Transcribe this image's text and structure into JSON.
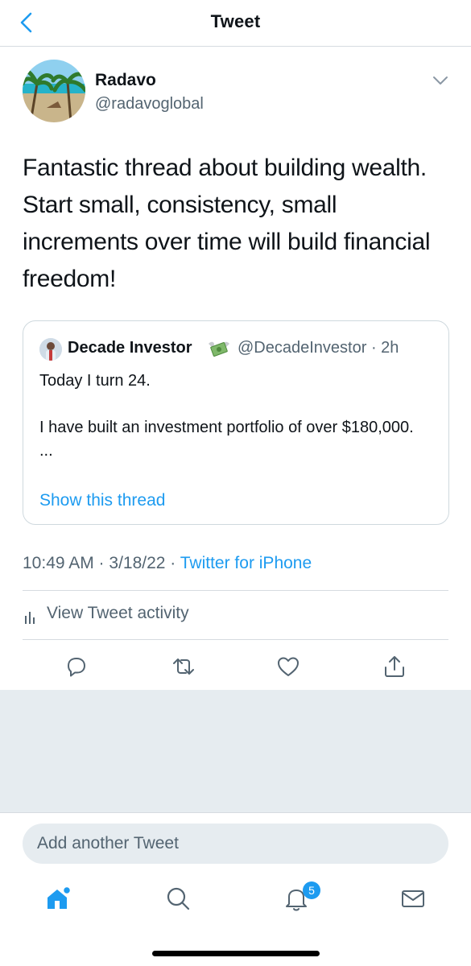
{
  "header": {
    "title": "Tweet",
    "back_icon": "chevron-left-icon"
  },
  "author": {
    "name": "Radavo",
    "handle": "@radavoglobal"
  },
  "tweet": {
    "text": "Fantastic thread about building wealth. Start small, consistency, small increments over time will build financial freedom!"
  },
  "quote": {
    "name": "Decade Investor",
    "emoji_icon": "money-with-wings-icon",
    "meta": "@DecadeInvestor · 2h",
    "text": "Today I turn 24.\n\nI have built an investment portfolio of over $180,000.\n...",
    "show_thread": "Show this thread"
  },
  "meta": {
    "time_date": "10:49 AM · 3/18/22 · ",
    "source": "Twitter for iPhone"
  },
  "activity": {
    "label": "View Tweet activity"
  },
  "actions": [
    "reply-icon",
    "retweet-icon",
    "like-icon",
    "share-icon"
  ],
  "compose": {
    "placeholder": "Add another Tweet"
  },
  "tabbar": {
    "notification_count": "5"
  },
  "colors": {
    "accent": "#1d9bf0",
    "secondary_text": "#536471",
    "divider": "#d6dbe0",
    "canvas": "#e6ecf0"
  }
}
